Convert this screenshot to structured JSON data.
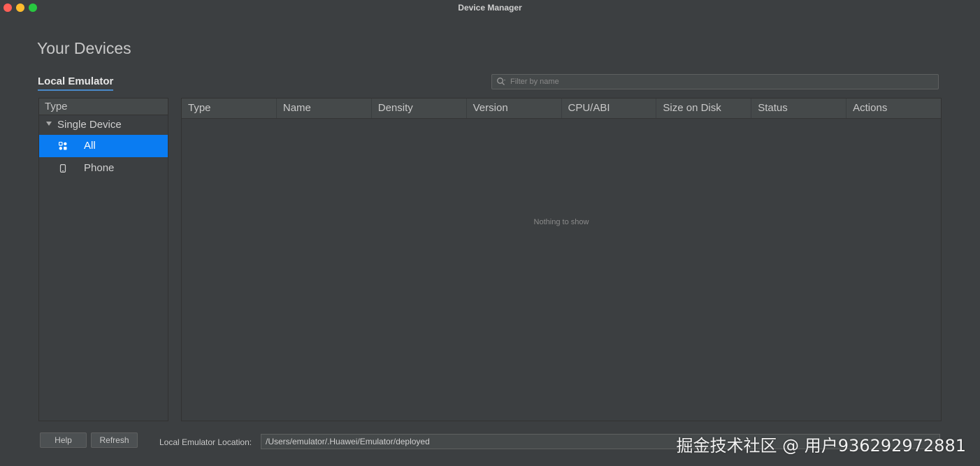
{
  "window": {
    "title": "Device Manager"
  },
  "page": {
    "title": "Your Devices",
    "tab_label": "Local Emulator"
  },
  "filter": {
    "placeholder": "Filter by name",
    "icon": "search-icon"
  },
  "sidebar": {
    "header": "Type",
    "group_label": "Single Device",
    "items": [
      {
        "label": "All",
        "icon": "grid-icon",
        "selected": true
      },
      {
        "label": "Phone",
        "icon": "phone-icon",
        "selected": false
      }
    ]
  },
  "table": {
    "columns": [
      "Type",
      "Name",
      "Density",
      "Version",
      "CPU/ABI",
      "Size on Disk",
      "Status",
      "Actions"
    ],
    "rows": [],
    "empty_message": "Nothing to show"
  },
  "footer": {
    "help_label": "Help",
    "refresh_label": "Refresh",
    "location_label": "Local Emulator Location:",
    "location_value": "/Users/emulator/.Huawei/Emulator/deployed"
  },
  "watermark": {
    "text": "掘金技术社区 @ 用户936292972881"
  },
  "colors": {
    "background": "#3c3f41",
    "selection": "#0a7cf2",
    "tab_underline": "#4a88c7"
  }
}
